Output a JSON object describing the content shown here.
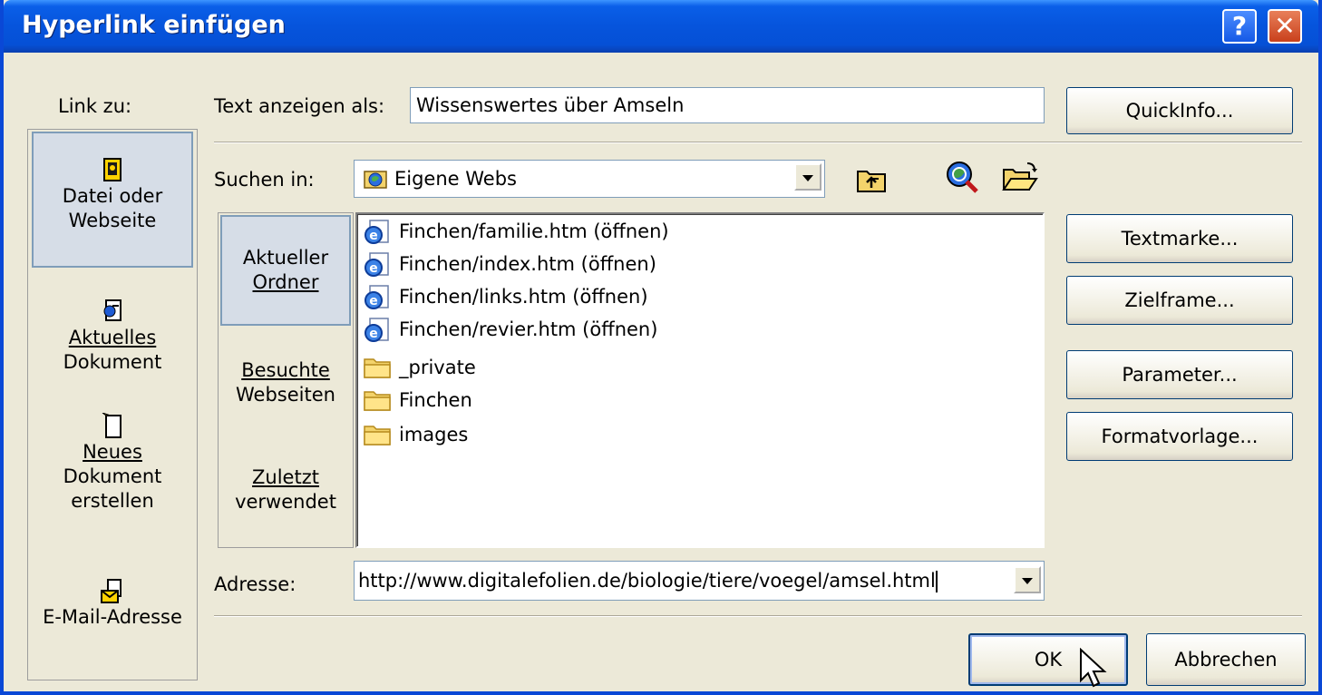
{
  "window": {
    "title": "Hyperlink einfügen"
  },
  "titlebar": {
    "help_label": "?",
    "close_label": "✕"
  },
  "link_to": {
    "label": "Link zu:",
    "items": [
      {
        "line1": "Datei oder",
        "line2": "Webseite",
        "icon": "file-webpage-icon"
      },
      {
        "line1": "Aktuelles",
        "line2": "Dokument",
        "icon": "current-document-icon"
      },
      {
        "line1": "Neues",
        "line2": "Dokument",
        "line3": "erstellen",
        "icon": "new-document-icon"
      },
      {
        "line1": "E-Mail-Adresse",
        "icon": "email-icon"
      }
    ]
  },
  "display_text": {
    "label": "Text anzeigen als:",
    "value": "Wissenswertes über Amseln"
  },
  "quickinfo_button": "QuickInfo...",
  "look_in": {
    "label": "Suchen in:",
    "value": "Eigene Webs"
  },
  "places": [
    {
      "line1": "Aktueller",
      "line2": "Ordner"
    },
    {
      "line1": "Besuchte",
      "line2": "Webseiten"
    },
    {
      "line1": "Zuletzt",
      "line2": "verwendet"
    }
  ],
  "files": [
    {
      "name": "Finchen/familie.htm (öffnen)",
      "icon": "ie-page-icon"
    },
    {
      "name": "Finchen/index.htm (öffnen)",
      "icon": "ie-page-icon"
    },
    {
      "name": "Finchen/links.htm (öffnen)",
      "icon": "ie-page-icon"
    },
    {
      "name": "Finchen/revier.htm (öffnen)",
      "icon": "ie-page-icon"
    },
    {
      "name": "_private",
      "icon": "folder-icon"
    },
    {
      "name": "Finchen",
      "icon": "folder-icon"
    },
    {
      "name": "images",
      "icon": "folder-icon"
    }
  ],
  "address": {
    "label": "Adresse:",
    "value": "http://www.digitalefolien.de/biologie/tiere/voegel/amsel.html"
  },
  "side_buttons": {
    "bookmark": "Textmarke...",
    "target_frame": "Zielframe...",
    "parameters": "Parameter...",
    "style": "Formatvorlage..."
  },
  "footer": {
    "ok": "OK",
    "cancel": "Abbrechen"
  },
  "colors": {
    "titlebar": "#0654dc",
    "face": "#ece9d8",
    "selected": "#d6dde7"
  }
}
